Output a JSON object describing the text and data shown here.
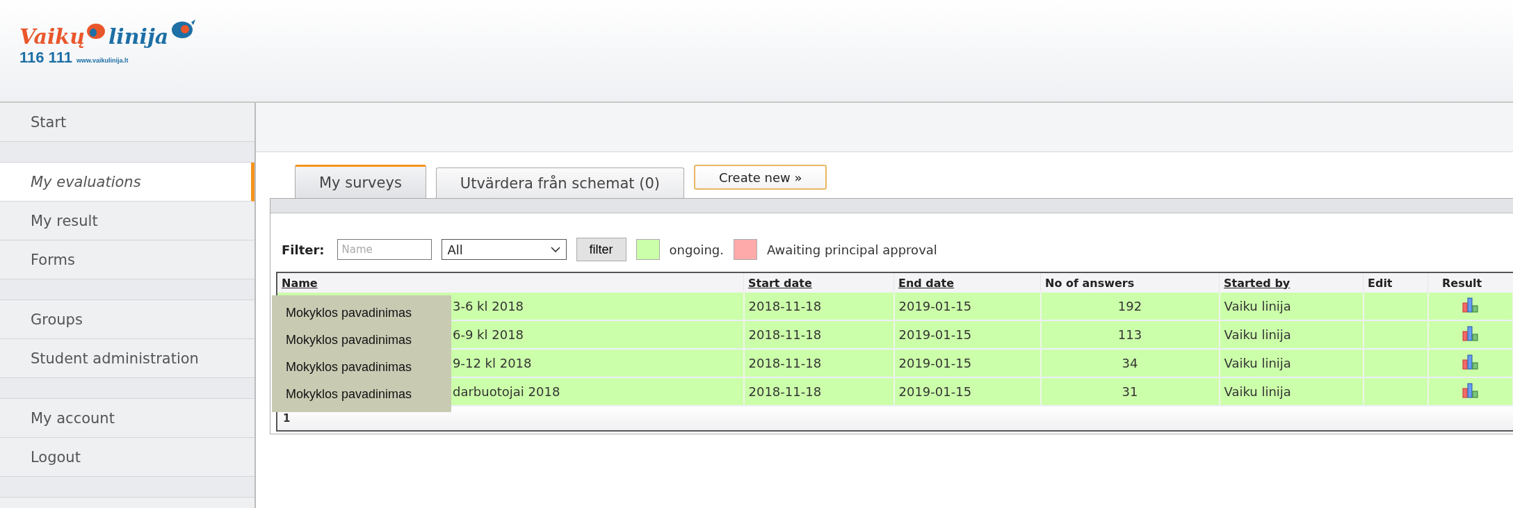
{
  "logo": {
    "wordmark_left": "Vaikų",
    "wordmark_right": "linija",
    "phone": "116 111",
    "url": "www.vaikulinija.lt"
  },
  "sidebar": {
    "items": [
      {
        "kind": "link",
        "label": "Start",
        "selected": false
      },
      {
        "kind": "spacer"
      },
      {
        "kind": "link",
        "label": "My evaluations",
        "selected": true
      },
      {
        "kind": "link",
        "label": "My result",
        "selected": false
      },
      {
        "kind": "link",
        "label": "Forms",
        "selected": false
      },
      {
        "kind": "spacer"
      },
      {
        "kind": "link",
        "label": "Groups",
        "selected": false
      },
      {
        "kind": "link",
        "label": "Student administration",
        "selected": false
      },
      {
        "kind": "spacer"
      },
      {
        "kind": "link",
        "label": "My account",
        "selected": false
      },
      {
        "kind": "link",
        "label": "Logout",
        "selected": false
      },
      {
        "kind": "spacer"
      }
    ]
  },
  "tabs": [
    {
      "label": "My surveys",
      "selected": true
    },
    {
      "label": "Utvärdera från schemat (0)",
      "selected": false
    }
  ],
  "create_button": "Create new »",
  "filter": {
    "label": "Filter:",
    "name_placeholder": "Name",
    "select_value": "All",
    "button": "filter",
    "legend": [
      {
        "color": "#ccffaa",
        "label": "ongoing."
      },
      {
        "color": "#ffaaaa",
        "label": "Awaiting principal approval"
      }
    ]
  },
  "table": {
    "columns": [
      {
        "label": "Name",
        "sortable": true
      },
      {
        "label": "Start date",
        "sortable": true
      },
      {
        "label": "End date",
        "sortable": true
      },
      {
        "label": "No of answers",
        "sortable": false
      },
      {
        "label": "Started by",
        "sortable": true
      },
      {
        "label": "Edit",
        "sortable": false
      },
      {
        "label": "Result",
        "sortable": false
      }
    ],
    "rows": [
      {
        "color": "#ccffaa",
        "name": "3-6 kl 2018",
        "start": "2018-11-18",
        "end": "2019-01-15",
        "answers": "192",
        "started_by": "Vaiku linija"
      },
      {
        "color": "#ccffaa",
        "name": "6-9 kl 2018",
        "start": "2018-11-18",
        "end": "2019-01-15",
        "answers": "113",
        "started_by": "Vaiku linija"
      },
      {
        "color": "#ccffaa",
        "name": "9-12 kl 2018",
        "start": "2018-11-18",
        "end": "2019-01-15",
        "answers": "34",
        "started_by": "Vaiku linija"
      },
      {
        "color": "#ccffaa",
        "name": "darbuotojai 2018",
        "start": "2018-11-18",
        "end": "2019-01-15",
        "answers": "31",
        "started_by": "Vaiku linija"
      }
    ],
    "pager": "1"
  },
  "tooltip": {
    "items": [
      "Mokyklos pavadinimas",
      "Mokyklos pavadinimas",
      "Mokyklos pavadinimas",
      "Mokyklos pavadinimas"
    ]
  }
}
